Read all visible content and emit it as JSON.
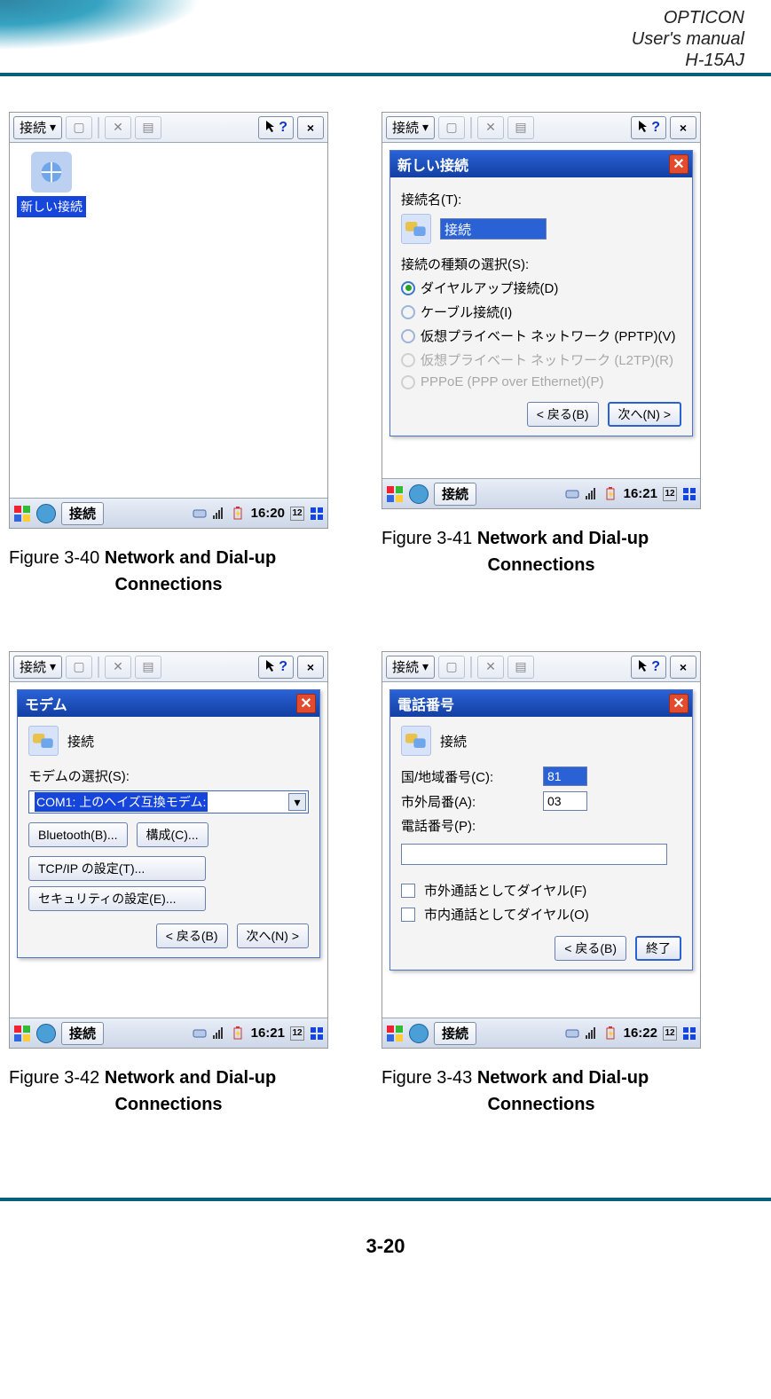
{
  "header": {
    "line1": "OPTICON",
    "line2": "User's manual",
    "line3": "H-15AJ"
  },
  "footer": {
    "page_number": "3-20"
  },
  "common": {
    "toolbar_title": "接続",
    "help_icon": "help-icon",
    "close_x": "×"
  },
  "fig40": {
    "caption_prefix": "Figure 3-40 ",
    "caption_bold": "Network and Dial-up",
    "caption_line2": "Connections",
    "new_connection_label": "新しい接続",
    "taskbar": {
      "task_label": "接続",
      "time": "16:20",
      "date_badge": "12"
    }
  },
  "fig41": {
    "caption_prefix": "Figure 3-41 ",
    "caption_bold": "Network and Dial-up",
    "caption_line2": "Connections",
    "dialog": {
      "title": "新しい接続",
      "name_label": "接続名(T):",
      "name_value": "接続",
      "type_label": "接続の種類の選択(S):",
      "opts": [
        {
          "label": "ダイヤルアップ接続(D)",
          "state": "on",
          "dim": false
        },
        {
          "label": "ケーブル接続(I)",
          "state": "off",
          "dim": false
        },
        {
          "label": "仮想プライベート ネットワーク (PPTP)(V)",
          "state": "off",
          "dim": false
        },
        {
          "label": "仮想プライベート ネットワーク (L2TP)(R)",
          "state": "off",
          "dim": true
        },
        {
          "label": "PPPoE (PPP over Ethernet)(P)",
          "state": "off",
          "dim": true
        }
      ],
      "back": "< 戻る(B)",
      "next": "次へ(N) >"
    },
    "taskbar": {
      "task_label": "接続",
      "time": "16:21",
      "date_badge": "12"
    }
  },
  "fig42": {
    "caption_prefix": "Figure 3-42 ",
    "caption_bold": "Network and Dial-up",
    "caption_line2": "Connections",
    "dialog": {
      "title": "モデム",
      "conn_label": "接続",
      "select_label": "モデムの選択(S):",
      "combo_value": "COM1: 上のヘイズ互換モデム:",
      "btn_bluetooth": "Bluetooth(B)...",
      "btn_config": "構成(C)...",
      "btn_tcpip": "TCP/IP の設定(T)...",
      "btn_security": "セキュリティの設定(E)...",
      "back": "< 戻る(B)",
      "next": "次へ(N) >"
    },
    "taskbar": {
      "task_label": "接続",
      "time": "16:21",
      "date_badge": "12"
    }
  },
  "fig43": {
    "caption_prefix": "Figure 3-43 ",
    "caption_bold": "Network and Dial-up",
    "caption_line2": "Connections",
    "dialog": {
      "title": "電話番号",
      "conn_label": "接続",
      "country_label": "国/地域番号(C):",
      "country_value": "81",
      "area_label": "市外局番(A):",
      "area_value": "03",
      "phone_label": "電話番号(P):",
      "phone_value": "",
      "chk1": "市外通話としてダイヤル(F)",
      "chk2": "市内通話としてダイヤル(O)",
      "back": "< 戻る(B)",
      "finish": "終了"
    },
    "taskbar": {
      "task_label": "接続",
      "time": "16:22",
      "date_badge": "12"
    }
  }
}
